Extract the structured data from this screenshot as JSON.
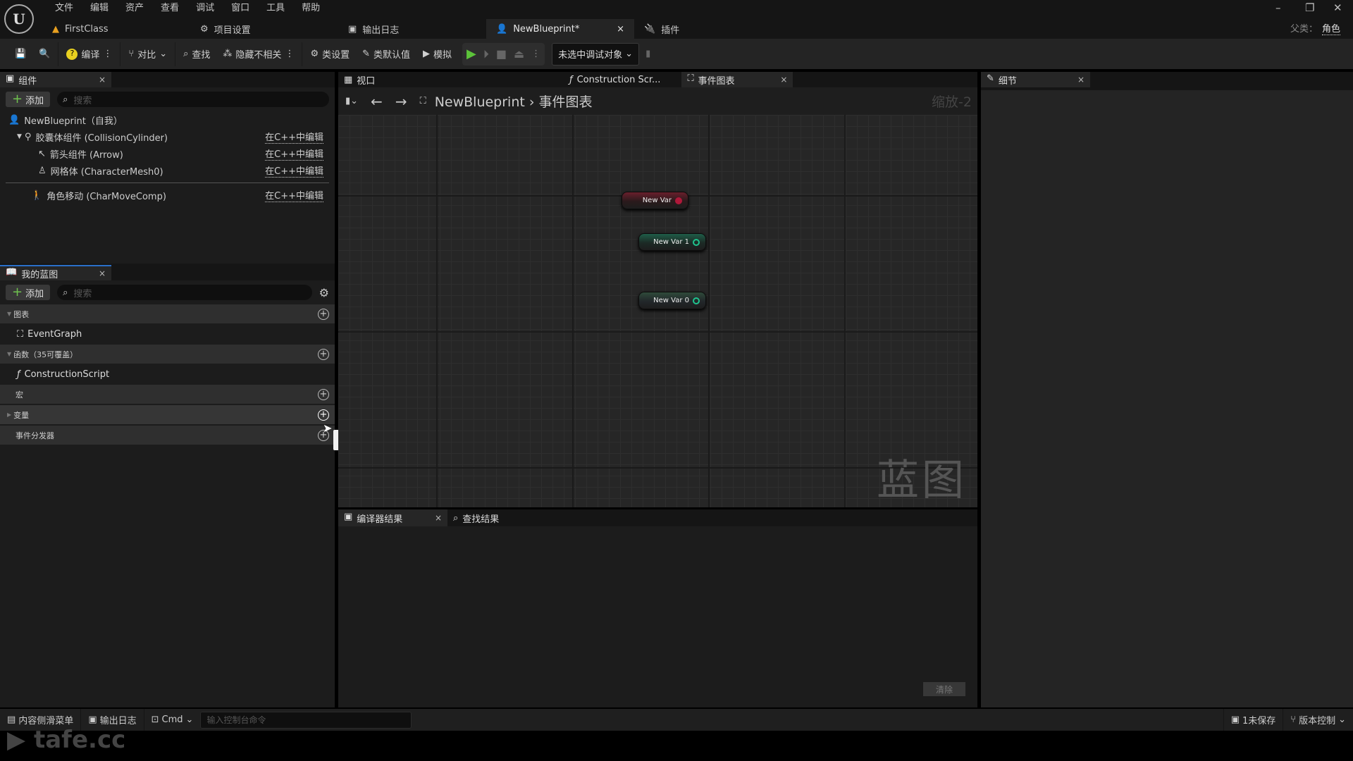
{
  "menu": [
    "文件",
    "编辑",
    "资产",
    "查看",
    "调试",
    "窗口",
    "工具",
    "帮助"
  ],
  "doc_tabs": [
    {
      "label": "FirstClass"
    },
    {
      "label": "项目设置"
    },
    {
      "label": "输出日志"
    },
    {
      "label": "NewBlueprint*",
      "active": true
    },
    {
      "label": "插件"
    }
  ],
  "parent_class": {
    "label": "父类：",
    "value": "角色"
  },
  "toolbar": {
    "compile": "编译",
    "diff": "对比",
    "find": "查找",
    "hide_unrelated": "隐藏不相关",
    "class_settings": "类设置",
    "class_defaults": "类默认值",
    "simulate": "模拟",
    "debug_target": "未选中调试对象"
  },
  "components": {
    "tab": "组件",
    "add": "添加",
    "search_placeholder": "搜索",
    "root": "NewBlueprint（自我）",
    "edit_link": "在C++中编辑",
    "items": [
      {
        "label": "胶囊体组件 (CollisionCylinder)"
      },
      {
        "label": "箭头组件 (Arrow)"
      },
      {
        "label": "网格体 (CharacterMesh0)"
      },
      {
        "label": "角色移动 (CharMoveComp)"
      }
    ]
  },
  "my_blueprint": {
    "tab": "我的蓝图",
    "add": "添加",
    "search_placeholder": "搜索",
    "graphs": "图表",
    "event_graph": "EventGraph",
    "functions": "函数（35可覆盖）",
    "construction_script": "ConstructionScript",
    "macros": "宏",
    "variables": "变量",
    "dispatchers": "事件分发器",
    "tooltip": "变量"
  },
  "graph_tabs": [
    "视口",
    "Construction Scr...",
    "事件图表"
  ],
  "breadcrumb": {
    "blueprint": "NewBlueprint",
    "graph": "事件图表",
    "zoom": "缩放-2",
    "watermark": "蓝图"
  },
  "nodes": [
    {
      "label": "New Var",
      "color": "#b0183a"
    },
    {
      "label": "New Var 1",
      "color": "#1fc48e"
    },
    {
      "label": "New Var 0",
      "color": "#1fc48e"
    }
  ],
  "bottom_tabs": {
    "compiler": "编译器结果",
    "find": "查找结果",
    "clear": "清除"
  },
  "details": {
    "tab": "细节"
  },
  "status": {
    "content_drawer": "内容侧滑菜单",
    "output_log": "输出日志",
    "cmd": "Cmd",
    "console_placeholder": "输入控制台命令",
    "unsaved": "1未保存",
    "source_control": "版本控制"
  },
  "watermark_logo": "tafe.cc"
}
